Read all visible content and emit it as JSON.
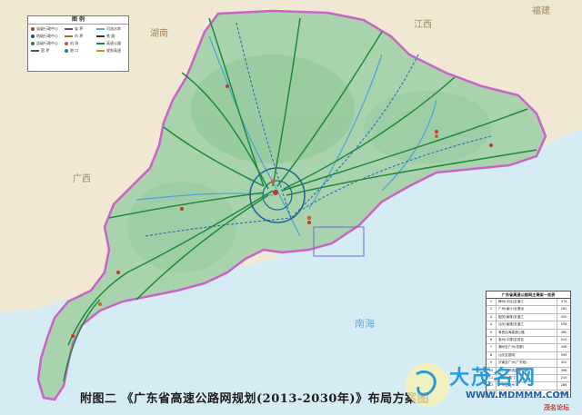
{
  "map_title": "附图二 《广东省高速公路网规划(2013-2030年)》布局方案图",
  "legend": {
    "heading": "图  例",
    "items": [
      "省级行政中心",
      "地级行政中心",
      "县级行政中心",
      "国  界",
      "省  界",
      "市  界",
      "机  场",
      "港  口",
      "河流水库",
      "铁  路",
      "高速公路",
      "规划高速"
    ],
    "colors": [
      "#c0392b",
      "#1d4e89",
      "#2a7f3f",
      "#555555",
      "#7b3fa0",
      "#b5651d",
      "#d65a2c",
      "#2c6fb5",
      "#5fa8d3",
      "#333333",
      "#1f8a3a",
      "#e08a1e"
    ]
  },
  "provinces": [
    "福建",
    "湖南",
    "广西",
    "江西"
  ],
  "seas": [
    "南海"
  ],
  "table": {
    "title": "广东省高速公路网主骨架一览表",
    "rows": [
      {
        "no": "1",
        "name": "梅州(平远)至湛江",
        "km": "374"
      },
      {
        "no": "2",
        "name": "广州(南沙)至清远",
        "km": "262"
      },
      {
        "no": "3",
        "name": "韶关(南雄)至湛江",
        "km": "450"
      },
      {
        "no": "4",
        "name": "汕头(南澳)至湛江",
        "km": "558"
      },
      {
        "no": "5",
        "name": "粤西沿海高速公路",
        "km": "480"
      },
      {
        "no": "6",
        "name": "惠州(平潭)至茂名",
        "km": "510"
      },
      {
        "no": "7",
        "name": "潮州至广州(花都)",
        "km": "436"
      },
      {
        "no": "8",
        "name": "汕头至昆明",
        "km": "395"
      },
      {
        "no": "9",
        "name": "济南至广州(广东段)",
        "km": "320"
      },
      {
        "no": "10",
        "name": "珠三角环线高速公路",
        "km": "398"
      },
      {
        "no": "11",
        "name": "广州至澳门",
        "km": "210"
      },
      {
        "no": "12",
        "name": "广州至连州",
        "km": "286"
      },
      {
        "no": "13",
        "name": "合  计",
        "km": "4679"
      }
    ]
  },
  "watermark": {
    "site_name": "大茂名网",
    "url": "WWW.MDMMM.COM",
    "forum": "茂名论坛"
  },
  "colors": {
    "province_fill": "#a8d3ad",
    "sea": "#d6ecf5",
    "land_outside": "#f1e8d4",
    "border": "#c864c8",
    "expressway": "#1f8a3a",
    "planned": "#2b6fb0",
    "rivers": "#4da3d8"
  }
}
